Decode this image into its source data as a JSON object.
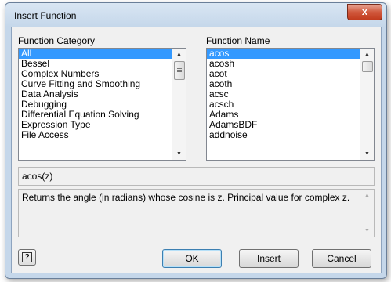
{
  "window": {
    "title": "Insert Function",
    "close_glyph": "x"
  },
  "category": {
    "label": "Function Category",
    "items": [
      "All",
      "Bessel",
      "Complex Numbers",
      "Curve Fitting and Smoothing",
      "Data Analysis",
      "Debugging",
      "Differential Equation Solving",
      "Expression Type",
      "File Access"
    ],
    "selected_index": 0
  },
  "function_name": {
    "label": "Function Name",
    "items": [
      "acos",
      "acosh",
      "acot",
      "acoth",
      "acsc",
      "acsch",
      "Adams",
      "AdamsBDF",
      "addnoise"
    ],
    "selected_index": 0
  },
  "syntax": "acos(z)",
  "description": "Returns the angle (in radians) whose cosine is z. Principal value for complex z.",
  "buttons": {
    "ok": "OK",
    "insert": "Insert",
    "cancel": "Cancel",
    "help_glyph": "?"
  },
  "icons": {
    "help": "help-icon",
    "close": "close-icon",
    "scroll_up": "scroll-up-arrow-icon",
    "scroll_down": "scroll-down-arrow-icon"
  }
}
